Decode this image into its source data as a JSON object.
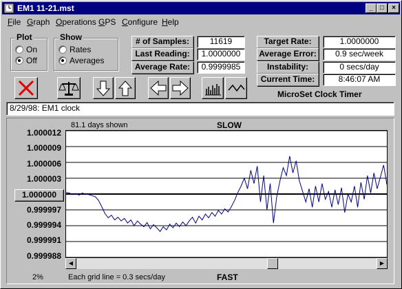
{
  "window": {
    "title": "EM1 11-21.mst",
    "controls": [
      "minimize",
      "maximize",
      "close"
    ]
  },
  "menu": [
    {
      "label": "File",
      "underline": "F"
    },
    {
      "label": "Graph",
      "underline": "G"
    },
    {
      "label": "Operations",
      "underline": "O"
    },
    {
      "label": "GPS",
      "underline": "G"
    },
    {
      "label": "Configure",
      "underline": "C"
    },
    {
      "label": "Help",
      "underline": "H"
    }
  ],
  "plot_group": {
    "label": "Plot",
    "options": [
      {
        "label": "On",
        "selected": false
      },
      {
        "label": "Off",
        "selected": true
      }
    ]
  },
  "show_group": {
    "label": "Show",
    "options": [
      {
        "label": "Rates",
        "selected": false
      },
      {
        "label": "Averages",
        "selected": true
      }
    ]
  },
  "stats_left": [
    {
      "label": "# of Samples:",
      "value": "11619"
    },
    {
      "label": "Last Reading:",
      "value": "1.0000000"
    },
    {
      "label": "Average Rate:",
      "value": "0.9999985"
    }
  ],
  "stats_right": [
    {
      "label": "Target Rate:",
      "value": "1.0000000"
    },
    {
      "label": "Average Error:",
      "value": "0.9 sec/week"
    },
    {
      "label": "Instability:",
      "value": "0 secs/day"
    },
    {
      "label": "Current Time:",
      "value": "8:46:07 AM"
    }
  ],
  "toolbar": [
    {
      "name": "delete-button",
      "icon": "red-x-icon"
    },
    {
      "name": "balance-button",
      "icon": "scales-icon"
    },
    {
      "name": "scroll-down-button",
      "icon": "arrow-down-icon"
    },
    {
      "name": "scroll-up-button",
      "icon": "arrow-up-icon"
    },
    {
      "name": "scroll-left-button",
      "icon": "arrow-left-icon"
    },
    {
      "name": "scroll-right-button",
      "icon": "arrow-right-icon"
    },
    {
      "name": "bar-view-button",
      "icon": "bar-chart-icon"
    },
    {
      "name": "line-view-button",
      "icon": "line-chart-icon"
    }
  ],
  "app_title": "MicroSet Clock Timer",
  "note": "8/29/98: EM1 clock",
  "graph": {
    "days_shown": "81.1 days shown",
    "top_label": "SLOW",
    "bottom_label": "FAST",
    "reference_value": "1.000000",
    "y_ticks": [
      "1.000012",
      "1.000009",
      "1.000006",
      "1.000003",
      "1.000000",
      "0.999997",
      "0.999994",
      "0.999991",
      "0.999988"
    ],
    "zoom": "2%",
    "grid_note": "Each grid line = 0.3 secs/day",
    "scroll_position": 0.66
  },
  "chart_data": {
    "type": "line",
    "ylim": [
      0.999988,
      1.000012
    ],
    "grid": true,
    "series": [
      {
        "values": [
          1.0000003,
          1.0000002,
          0.9999999,
          1.0000001,
          0.9999998,
          1.0000002,
          1.0,
          0.9999999,
          0.9999997,
          0.9999995,
          0.9999988,
          0.9999976,
          0.9999963,
          0.9999955,
          0.999996,
          0.9999951,
          0.9999956,
          0.9999949,
          0.9999954,
          0.9999945,
          0.9999951,
          0.999994,
          0.9999949,
          0.9999943,
          0.9999938,
          0.9999946,
          0.9999934,
          0.9999942,
          0.9999936,
          0.9999929,
          0.9999938,
          0.9999932,
          0.9999943,
          0.9999936,
          0.9999945,
          0.9999938,
          0.9999947,
          0.999994,
          0.9999949,
          0.9999956,
          0.9999945,
          0.9999958,
          0.9999951,
          0.9999962,
          0.9999955,
          0.9999965,
          0.9999958,
          0.9999969,
          0.9999962,
          0.9999972,
          0.9999966,
          0.9999976,
          0.9999988,
          1.0000003,
          1.0000015,
          1.000003,
          1.000001,
          1.0000045,
          1.000002,
          1.0000053,
          0.9999985,
          1.0000035,
          0.999997,
          1.000002,
          0.9999945,
          0.9999995,
          1.0000025,
          1.000005,
          1.0000035,
          1.0000072,
          1.000004,
          1.0000063,
          1.0000025,
          1.0000005,
          0.9999985,
          1.000001,
          0.9999975,
          1.0000015,
          0.9999985,
          1.000002,
          0.999999,
          1.0000005,
          0.9999975,
          1.0000008,
          0.999998,
          1.0000012,
          0.9999965,
          1.0,
          0.9999985,
          1.0000015,
          0.9999975,
          1.0000022,
          0.999999,
          1.0000035,
          1.0000002,
          1.000004,
          1.000001,
          1.0000032,
          1.0000055,
          1.0000018
        ]
      }
    ]
  }
}
